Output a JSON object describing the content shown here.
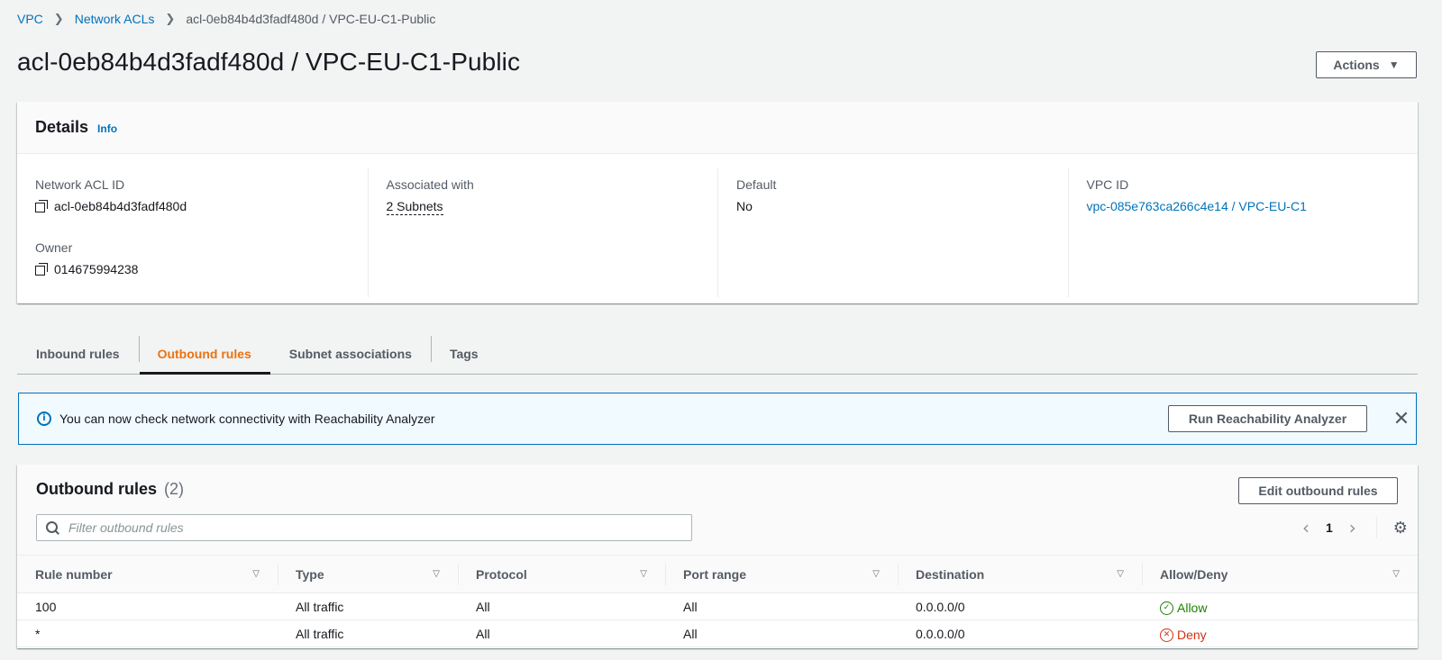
{
  "breadcrumb": {
    "items": [
      "VPC",
      "Network ACLs"
    ],
    "current": "acl-0eb84b4d3fadf480d / VPC-EU-C1-Public"
  },
  "page_title": "acl-0eb84b4d3fadf480d / VPC-EU-C1-Public",
  "actions_label": "Actions",
  "details": {
    "title": "Details",
    "info_label": "Info",
    "network_acl_id_label": "Network ACL ID",
    "network_acl_id": "acl-0eb84b4d3fadf480d",
    "owner_label": "Owner",
    "owner": "014675994238",
    "associated_label": "Associated with",
    "associated": "2 Subnets",
    "default_label": "Default",
    "default": "No",
    "vpc_id_label": "VPC ID",
    "vpc_id": "vpc-085e763ca266c4e14 / VPC-EU-C1"
  },
  "tabs": [
    "Inbound rules",
    "Outbound rules",
    "Subnet associations",
    "Tags"
  ],
  "active_tab": "Outbound rules",
  "flash": {
    "message": "You can now check network connectivity with Reachability Analyzer",
    "button": "Run Reachability Analyzer"
  },
  "rules": {
    "title": "Outbound rules",
    "count": "(2)",
    "edit_button": "Edit outbound rules",
    "filter_placeholder": "Filter outbound rules",
    "page": "1",
    "columns": [
      "Rule number",
      "Type",
      "Protocol",
      "Port range",
      "Destination",
      "Allow/Deny"
    ],
    "rows": [
      {
        "rule": "100",
        "type": "All traffic",
        "protocol": "All",
        "port": "All",
        "destination": "0.0.0.0/0",
        "action": "Allow"
      },
      {
        "rule": "*",
        "type": "All traffic",
        "protocol": "All",
        "port": "All",
        "destination": "0.0.0.0/0",
        "action": "Deny"
      }
    ]
  },
  "colors": {
    "link": "#0073bb",
    "active_tab": "#ec7211",
    "allow": "#1d8102",
    "deny": "#d13212",
    "flash_bg": "#f1faff"
  }
}
